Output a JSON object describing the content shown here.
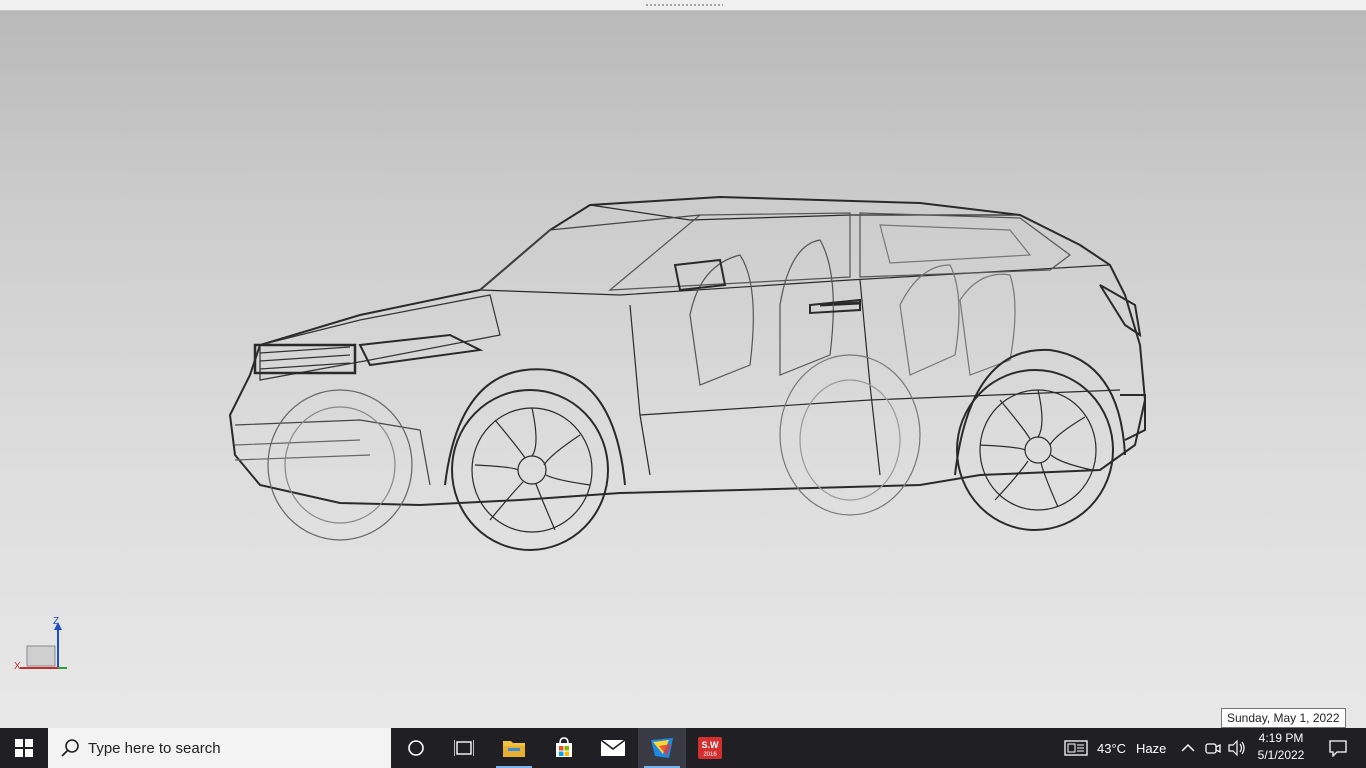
{
  "viewport": {
    "triad": {
      "z_label": "Z",
      "x_label": "X"
    },
    "model_name": "wireframe-suv"
  },
  "tooltip": {
    "text": "Sunday, May 1, 2022"
  },
  "taskbar": {
    "start_icon": "windows-logo-icon",
    "search": {
      "placeholder": "Type here to search",
      "icon": "search-icon"
    },
    "buttons": [
      {
        "name": "cortana-button",
        "icon": "circle-icon"
      },
      {
        "name": "task-view-button",
        "icon": "task-view-icon"
      },
      {
        "name": "file-explorer-button",
        "icon": "folder-icon"
      },
      {
        "name": "microsoft-store-button",
        "icon": "store-icon"
      },
      {
        "name": "mail-button",
        "icon": "mail-icon"
      },
      {
        "name": "cad-viewer-button",
        "icon": "cad-app-icon"
      },
      {
        "name": "solidworks-button",
        "icon": "solidworks-icon",
        "label": "2016"
      }
    ],
    "weather": {
      "temp": "43°C",
      "condition": "Haze",
      "icon": "news-weather-icon"
    },
    "tray_icons": [
      "chevron-up-icon",
      "meet-now-icon",
      "speaker-icon"
    ],
    "clock": {
      "time": "4:19 PM",
      "date": "5/1/2022"
    },
    "notification_icon": "action-center-icon"
  },
  "colors": {
    "taskbar": "#1f1f24",
    "accent": "#78b4f0",
    "viewport_top": "#b8b8b8",
    "viewport_bottom": "#e8e8e8"
  }
}
